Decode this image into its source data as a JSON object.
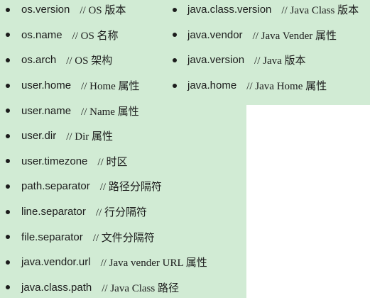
{
  "colors": {
    "background": "#d1ebd4",
    "text": "#1c1c1c"
  },
  "icons": {
    "bullet": "bullet-icon"
  },
  "left_column": [
    {
      "property": "os.version",
      "comment": "// OS 版本"
    },
    {
      "property": "os.name",
      "comment": "// OS 名称"
    },
    {
      "property": "os.arch",
      "comment": "// OS 架构"
    },
    {
      "property": "user.home",
      "comment": "// Home 属性"
    },
    {
      "property": "user.name",
      "comment": "// Name 属性"
    },
    {
      "property": "user.dir",
      "comment": "// Dir 属性"
    },
    {
      "property": "user.timezone",
      "comment": "// 时区"
    },
    {
      "property": "path.separator",
      "comment": "// 路径分隔符"
    },
    {
      "property": "line.separator",
      "comment": "// 行分隔符"
    },
    {
      "property": "file.separator",
      "comment": "// 文件分隔符"
    },
    {
      "property": "java.vendor.url",
      "comment": "// Java vender URL 属性"
    },
    {
      "property": "java.class.path",
      "comment": "// Java Class 路径"
    }
  ],
  "right_column": [
    {
      "property": "java.class.version",
      "comment": "// Java Class 版本"
    },
    {
      "property": "java.vendor",
      "comment": "// Java Vender 属性"
    },
    {
      "property": "java.version",
      "comment": "// Java 版本"
    },
    {
      "property": "java.home",
      "comment": "// Java Home 属性"
    }
  ]
}
